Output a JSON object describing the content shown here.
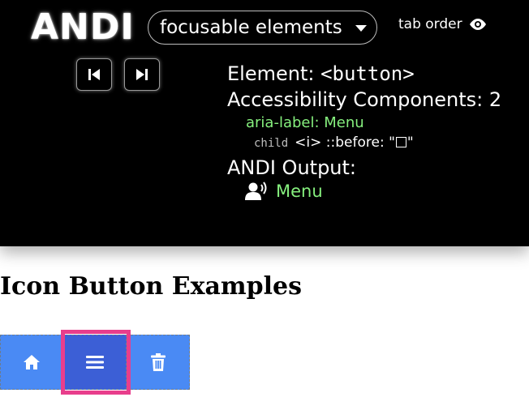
{
  "andi": {
    "logo": "ANDI",
    "module_select": {
      "selected": "focusable elements"
    },
    "tab_order": {
      "label": "tab order"
    },
    "output": {
      "element_label": "Element: ",
      "element_tag": "<button>",
      "components_label": "Accessibility Components: ",
      "components_count": "2",
      "aria_label_line": "aria-label: Menu",
      "child_tag": "child",
      "child_element": "<i>",
      "child_pseudo": " ::before: \"",
      "child_close": "\"",
      "output_heading": "ANDI Output:",
      "output_text": "Menu"
    }
  },
  "page": {
    "heading": "Icon Button Examples"
  },
  "colors": {
    "andi_background": "#000000",
    "output_green": "#86f07e",
    "button_blue": "#4a8af4",
    "button_selected": "#3c5fd6",
    "focus_highlight": "#e83e8c"
  },
  "icons": {
    "prev": "skip-previous-icon",
    "next": "skip-next-icon",
    "tab_order": "eye-icon",
    "output": "speaking-user-icon",
    "home": "home-icon",
    "menu": "hamburger-menu-icon",
    "trash": "trash-icon"
  }
}
